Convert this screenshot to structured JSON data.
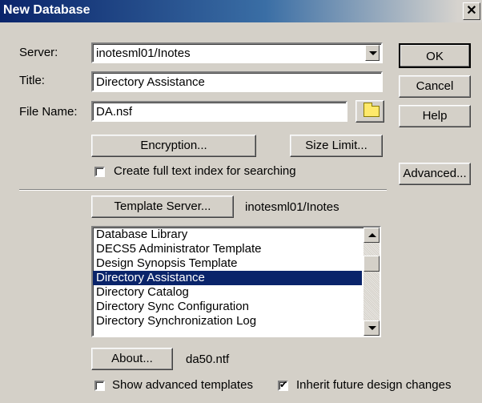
{
  "window": {
    "title": "New Database",
    "close_glyph": "✕"
  },
  "server": {
    "label": "Server:",
    "value": "inotesml01/Inotes"
  },
  "title_field": {
    "label": "Title:",
    "value": "Directory Assistance"
  },
  "filename": {
    "label": "File Name:",
    "value": "DA.nsf"
  },
  "buttons": {
    "ok": "OK",
    "cancel": "Cancel",
    "help": "Help",
    "encryption": "Encryption...",
    "size_limit": "Size Limit...",
    "advanced": "Advanced...",
    "template_server": "Template Server...",
    "about": "About..."
  },
  "full_text_index": {
    "label": "Create full text index for searching",
    "checked": false
  },
  "template_server_value": "inotesml01/Inotes",
  "templates": {
    "items": [
      "Database Library",
      "DECS5 Administrator Template",
      "Design Synopsis Template",
      "Directory Assistance",
      "Directory Catalog",
      "Directory Sync Configuration",
      "Directory Synchronization Log"
    ],
    "selected": "Directory Assistance"
  },
  "template_file": "da50.ntf",
  "show_advanced": {
    "label": "Show advanced templates",
    "checked": false
  },
  "inherit_changes": {
    "label": "Inherit future design changes",
    "checked": true
  },
  "icons": {
    "folder": "folder-icon",
    "dropdown": "chevron-down-icon",
    "close": "close-icon"
  }
}
